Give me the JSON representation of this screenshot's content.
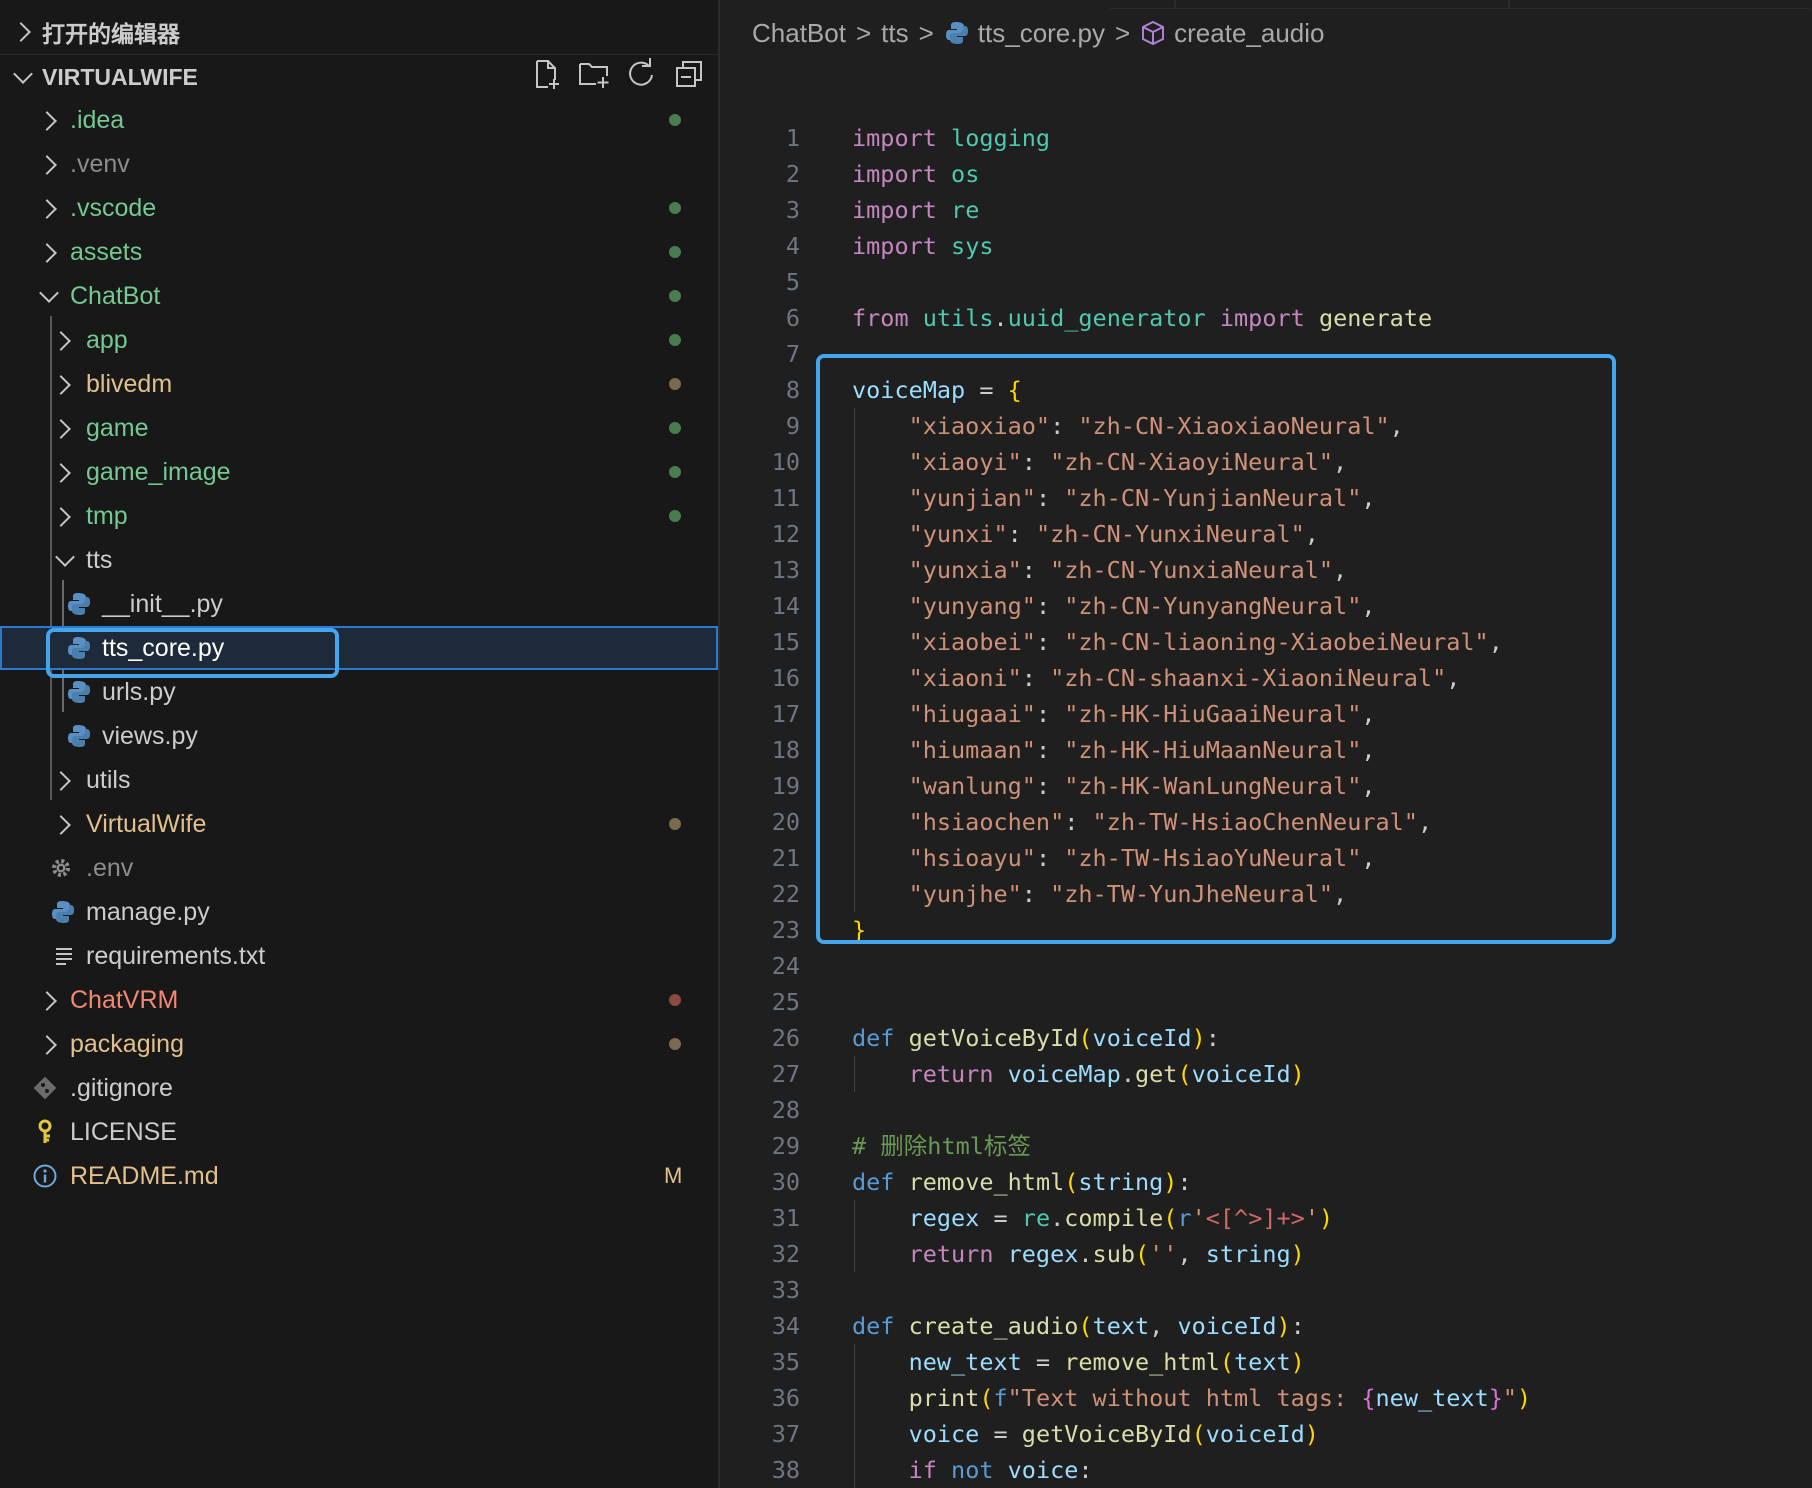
{
  "explorer": {
    "open_editors_label": "打开的编辑器",
    "workspace_label": "VIRTUALWIFE",
    "actions": [
      {
        "name": "new-file-icon"
      },
      {
        "name": "new-folder-icon"
      },
      {
        "name": "refresh-icon"
      },
      {
        "name": "collapse-all-icon"
      }
    ],
    "items": [
      {
        "label": ".idea",
        "color": "#73c991",
        "chevron": "right",
        "dot": "#4b7b52"
      },
      {
        "label": ".venv",
        "color": "#8c8c8c",
        "chevron": "right"
      },
      {
        "label": ".vscode",
        "color": "#73c991",
        "chevron": "right",
        "dot": "#4b7b52"
      },
      {
        "label": "assets",
        "color": "#73c991",
        "chevron": "right",
        "dot": "#4b7b52"
      },
      {
        "label": "ChatBot",
        "color": "#73c991",
        "chevron": "down",
        "dot": "#4b7b52"
      },
      {
        "label": "app",
        "color": "#73c991",
        "chevron": "right",
        "dot": "#4b7b52"
      },
      {
        "label": "blivedm",
        "color": "#e2c08d",
        "chevron": "right",
        "dot": "#7a6a4f"
      },
      {
        "label": "game",
        "color": "#73c991",
        "chevron": "right",
        "dot": "#4b7b52"
      },
      {
        "label": "game_image",
        "color": "#73c991",
        "chevron": "right",
        "dot": "#4b7b52"
      },
      {
        "label": "tmp",
        "color": "#73c991",
        "chevron": "right",
        "dot": "#4b7b52"
      },
      {
        "label": "tts",
        "color": "#cccccc",
        "chevron": "down"
      },
      {
        "label": "__init__.py",
        "color": "#cccccc",
        "icon": "python-file-icon"
      },
      {
        "label": "tts_core.py",
        "color": "#ffffff",
        "icon": "python-file-icon"
      },
      {
        "label": "urls.py",
        "color": "#cccccc",
        "icon": "python-file-icon"
      },
      {
        "label": "views.py",
        "color": "#cccccc",
        "icon": "python-file-icon"
      },
      {
        "label": "utils",
        "color": "#cccccc",
        "chevron": "right"
      },
      {
        "label": "VirtualWife",
        "color": "#e2c08d",
        "chevron": "right",
        "dot": "#7a6a4f"
      },
      {
        "label": ".env",
        "color": "#8c8c8c",
        "icon": "gear-icon"
      },
      {
        "label": "manage.py",
        "color": "#cccccc",
        "icon": "python-file-icon"
      },
      {
        "label": "requirements.txt",
        "color": "#cccccc",
        "icon": "lines-icon"
      },
      {
        "label": "ChatVRM",
        "color": "#f48771",
        "chevron": "right",
        "dot": "#8a4a42"
      },
      {
        "label": "packaging",
        "color": "#e2c08d",
        "chevron": "right",
        "dot": "#7a6a4f"
      },
      {
        "label": ".gitignore",
        "color": "#cccccc",
        "icon": "git-icon"
      },
      {
        "label": "LICENSE",
        "color": "#cccccc",
        "icon": "key-icon"
      },
      {
        "label": "README.md",
        "color": "#e2c08d",
        "icon": "info-icon",
        "badge": "M"
      }
    ]
  },
  "breadcrumb": {
    "items": [
      "ChatBot",
      "tts",
      "tts_core.py",
      "create_audio"
    ],
    "separator": ">"
  },
  "code": {
    "lines": [
      {
        "n": "1",
        "t": [
          [
            "kw",
            "import"
          ],
          [
            "p",
            " "
          ],
          [
            "mod",
            "logging"
          ]
        ]
      },
      {
        "n": "2",
        "t": [
          [
            "kw",
            "import"
          ],
          [
            "p",
            " "
          ],
          [
            "mod",
            "os"
          ]
        ]
      },
      {
        "n": "3",
        "t": [
          [
            "kw",
            "import"
          ],
          [
            "p",
            " "
          ],
          [
            "mod",
            "re"
          ]
        ]
      },
      {
        "n": "4",
        "t": [
          [
            "kw",
            "import"
          ],
          [
            "p",
            " "
          ],
          [
            "mod",
            "sys"
          ]
        ]
      },
      {
        "n": "5",
        "t": []
      },
      {
        "n": "6",
        "t": [
          [
            "kw",
            "from"
          ],
          [
            "p",
            " "
          ],
          [
            "mod",
            "utils"
          ],
          [
            "p",
            "."
          ],
          [
            "mod",
            "uuid_generator"
          ],
          [
            "p",
            " "
          ],
          [
            "kw",
            "import"
          ],
          [
            "p",
            " "
          ],
          [
            "fn",
            "generate"
          ]
        ]
      },
      {
        "n": "7",
        "t": []
      },
      {
        "n": "8",
        "t": [
          [
            "var",
            "voiceMap"
          ],
          [
            "p",
            " = "
          ],
          [
            "br1",
            "{"
          ]
        ]
      },
      {
        "n": "9",
        "t": [
          [
            "p",
            "    "
          ],
          [
            "str",
            "\"xiaoxiao\""
          ],
          [
            "p",
            ": "
          ],
          [
            "str",
            "\"zh-CN-XiaoxiaoNeural\""
          ],
          [
            "p",
            ","
          ]
        ]
      },
      {
        "n": "10",
        "t": [
          [
            "p",
            "    "
          ],
          [
            "str",
            "\"xiaoyi\""
          ],
          [
            "p",
            ": "
          ],
          [
            "str",
            "\"zh-CN-XiaoyiNeural\""
          ],
          [
            "p",
            ","
          ]
        ]
      },
      {
        "n": "11",
        "t": [
          [
            "p",
            "    "
          ],
          [
            "str",
            "\"yunjian\""
          ],
          [
            "p",
            ": "
          ],
          [
            "str",
            "\"zh-CN-YunjianNeural\""
          ],
          [
            "p",
            ","
          ]
        ]
      },
      {
        "n": "12",
        "t": [
          [
            "p",
            "    "
          ],
          [
            "str",
            "\"yunxi\""
          ],
          [
            "p",
            ": "
          ],
          [
            "str",
            "\"zh-CN-YunxiNeural\""
          ],
          [
            "p",
            ","
          ]
        ]
      },
      {
        "n": "13",
        "t": [
          [
            "p",
            "    "
          ],
          [
            "str",
            "\"yunxia\""
          ],
          [
            "p",
            ": "
          ],
          [
            "str",
            "\"zh-CN-YunxiaNeural\""
          ],
          [
            "p",
            ","
          ]
        ]
      },
      {
        "n": "14",
        "t": [
          [
            "p",
            "    "
          ],
          [
            "str",
            "\"yunyang\""
          ],
          [
            "p",
            ": "
          ],
          [
            "str",
            "\"zh-CN-YunyangNeural\""
          ],
          [
            "p",
            ","
          ]
        ]
      },
      {
        "n": "15",
        "t": [
          [
            "p",
            "    "
          ],
          [
            "str",
            "\"xiaobei\""
          ],
          [
            "p",
            ": "
          ],
          [
            "str",
            "\"zh-CN-liaoning-XiaobeiNeural\""
          ],
          [
            "p",
            ","
          ]
        ]
      },
      {
        "n": "16",
        "t": [
          [
            "p",
            "    "
          ],
          [
            "str",
            "\"xiaoni\""
          ],
          [
            "p",
            ": "
          ],
          [
            "str",
            "\"zh-CN-shaanxi-XiaoniNeural\""
          ],
          [
            "p",
            ","
          ]
        ]
      },
      {
        "n": "17",
        "t": [
          [
            "p",
            "    "
          ],
          [
            "str",
            "\"hiugaai\""
          ],
          [
            "p",
            ": "
          ],
          [
            "str",
            "\"zh-HK-HiuGaaiNeural\""
          ],
          [
            "p",
            ","
          ]
        ]
      },
      {
        "n": "18",
        "t": [
          [
            "p",
            "    "
          ],
          [
            "str",
            "\"hiumaan\""
          ],
          [
            "p",
            ": "
          ],
          [
            "str",
            "\"zh-HK-HiuMaanNeural\""
          ],
          [
            "p",
            ","
          ]
        ]
      },
      {
        "n": "19",
        "t": [
          [
            "p",
            "    "
          ],
          [
            "str",
            "\"wanlung\""
          ],
          [
            "p",
            ": "
          ],
          [
            "str",
            "\"zh-HK-WanLungNeural\""
          ],
          [
            "p",
            ","
          ]
        ]
      },
      {
        "n": "20",
        "t": [
          [
            "p",
            "    "
          ],
          [
            "str",
            "\"hsiaochen\""
          ],
          [
            "p",
            ": "
          ],
          [
            "str",
            "\"zh-TW-HsiaoChenNeural\""
          ],
          [
            "p",
            ","
          ]
        ]
      },
      {
        "n": "21",
        "t": [
          [
            "p",
            "    "
          ],
          [
            "str",
            "\"hsioayu\""
          ],
          [
            "p",
            ": "
          ],
          [
            "str",
            "\"zh-TW-HsiaoYuNeural\""
          ],
          [
            "p",
            ","
          ]
        ]
      },
      {
        "n": "22",
        "t": [
          [
            "p",
            "    "
          ],
          [
            "str",
            "\"yunjhe\""
          ],
          [
            "p",
            ": "
          ],
          [
            "str",
            "\"zh-TW-YunJheNeural\""
          ],
          [
            "p",
            ","
          ]
        ]
      },
      {
        "n": "23",
        "t": [
          [
            "br1",
            "}"
          ]
        ]
      },
      {
        "n": "24",
        "t": []
      },
      {
        "n": "25",
        "t": []
      },
      {
        "n": "26",
        "t": [
          [
            "kw2",
            "def"
          ],
          [
            "p",
            " "
          ],
          [
            "fn",
            "getVoiceById"
          ],
          [
            "br1",
            "("
          ],
          [
            "var",
            "voiceId"
          ],
          [
            "br1",
            ")"
          ],
          [
            "p",
            ":"
          ]
        ]
      },
      {
        "n": "27",
        "t": [
          [
            "p",
            "    "
          ],
          [
            "kw",
            "return"
          ],
          [
            "p",
            " "
          ],
          [
            "var",
            "voiceMap"
          ],
          [
            "p",
            "."
          ],
          [
            "fn",
            "get"
          ],
          [
            "br1",
            "("
          ],
          [
            "var",
            "voiceId"
          ],
          [
            "br1",
            ")"
          ]
        ]
      },
      {
        "n": "28",
        "t": []
      },
      {
        "n": "29",
        "t": [
          [
            "cm",
            "# 删除html标签"
          ]
        ]
      },
      {
        "n": "30",
        "t": [
          [
            "kw2",
            "def"
          ],
          [
            "p",
            " "
          ],
          [
            "fn",
            "remove_html"
          ],
          [
            "br1",
            "("
          ],
          [
            "var",
            "string"
          ],
          [
            "br1",
            ")"
          ],
          [
            "p",
            ":"
          ]
        ]
      },
      {
        "n": "31",
        "t": [
          [
            "p",
            "    "
          ],
          [
            "var",
            "regex"
          ],
          [
            "p",
            " = "
          ],
          [
            "mod",
            "re"
          ],
          [
            "p",
            "."
          ],
          [
            "fn",
            "compile"
          ],
          [
            "br1",
            "("
          ],
          [
            "kw2",
            "r"
          ],
          [
            "str",
            "'"
          ],
          [
            "re",
            "<[^>]+>"
          ],
          [
            "str",
            "'"
          ],
          [
            "br1",
            ")"
          ]
        ]
      },
      {
        "n": "32",
        "t": [
          [
            "p",
            "    "
          ],
          [
            "kw",
            "return"
          ],
          [
            "p",
            " "
          ],
          [
            "var",
            "regex"
          ],
          [
            "p",
            "."
          ],
          [
            "fn",
            "sub"
          ],
          [
            "br1",
            "("
          ],
          [
            "str",
            "''"
          ],
          [
            "p",
            ", "
          ],
          [
            "var",
            "string"
          ],
          [
            "br1",
            ")"
          ]
        ]
      },
      {
        "n": "33",
        "t": []
      },
      {
        "n": "34",
        "t": [
          [
            "kw2",
            "def"
          ],
          [
            "p",
            " "
          ],
          [
            "fn",
            "create_audio"
          ],
          [
            "br1",
            "("
          ],
          [
            "var",
            "text"
          ],
          [
            "p",
            ", "
          ],
          [
            "var",
            "voiceId"
          ],
          [
            "br1",
            ")"
          ],
          [
            "p",
            ":"
          ]
        ]
      },
      {
        "n": "35",
        "t": [
          [
            "p",
            "    "
          ],
          [
            "var",
            "new_text"
          ],
          [
            "p",
            " = "
          ],
          [
            "fn",
            "remove_html"
          ],
          [
            "br1",
            "("
          ],
          [
            "var",
            "text"
          ],
          [
            "br1",
            ")"
          ]
        ]
      },
      {
        "n": "36",
        "t": [
          [
            "p",
            "    "
          ],
          [
            "fn",
            "print"
          ],
          [
            "br1",
            "("
          ],
          [
            "kw2",
            "f"
          ],
          [
            "str",
            "\"Text without html tags: "
          ],
          [
            "br2",
            "{"
          ],
          [
            "var",
            "new_text"
          ],
          [
            "br2",
            "}"
          ],
          [
            "str",
            "\""
          ],
          [
            "br1",
            ")"
          ]
        ]
      },
      {
        "n": "37",
        "t": [
          [
            "p",
            "    "
          ],
          [
            "var",
            "voice"
          ],
          [
            "p",
            " = "
          ],
          [
            "fn",
            "getVoiceById"
          ],
          [
            "br1",
            "("
          ],
          [
            "var",
            "voiceId"
          ],
          [
            "br1",
            ")"
          ]
        ]
      },
      {
        "n": "38",
        "t": [
          [
            "p",
            "    "
          ],
          [
            "kw",
            "if"
          ],
          [
            "p",
            " "
          ],
          [
            "kw2",
            "not"
          ],
          [
            "p",
            " "
          ],
          [
            "var",
            "voice"
          ],
          [
            "p",
            ":"
          ]
        ]
      }
    ]
  },
  "colors": {
    "highlight": "#45a6ee",
    "sidebar_bg": "#181818",
    "editor_bg": "#1f1f1f"
  }
}
